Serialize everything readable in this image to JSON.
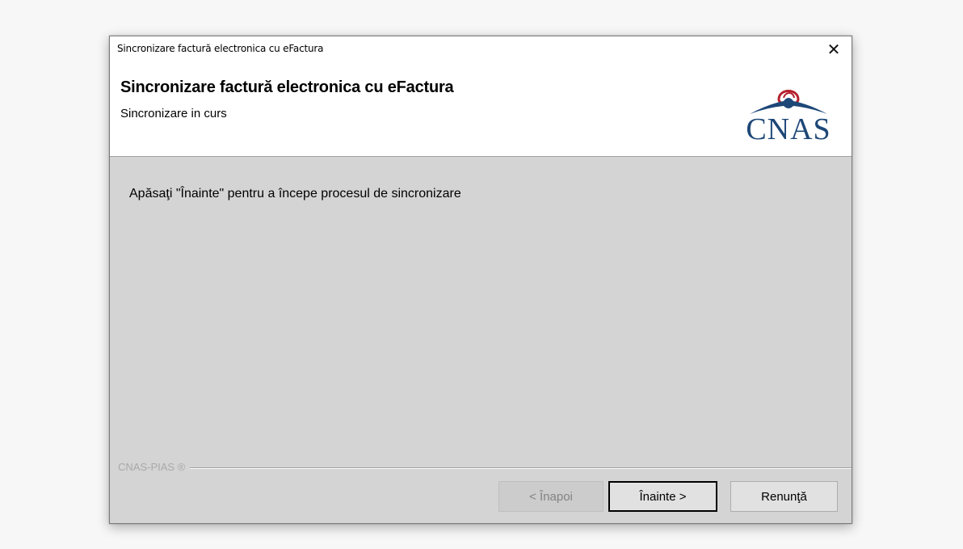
{
  "window": {
    "title": "Sincronizare factură electronica cu eFactura",
    "close_glyph": "✕"
  },
  "header": {
    "title": "Sincronizare factură electronica cu eFactura",
    "subtitle": "Sincronizare in curs",
    "logo_text": "CNAS",
    "logo_color": "#1d4777"
  },
  "main": {
    "message": "Apăsaţi \"Înainte\" pentru a începe procesul de sincronizare"
  },
  "footer": {
    "brand": "CNAS-PIAS ®",
    "buttons": {
      "back": "< Înapoi",
      "next": "Înainte >",
      "cancel": "Renunţă"
    }
  },
  "icons": [
    "close-icon",
    "cnas-logo"
  ]
}
